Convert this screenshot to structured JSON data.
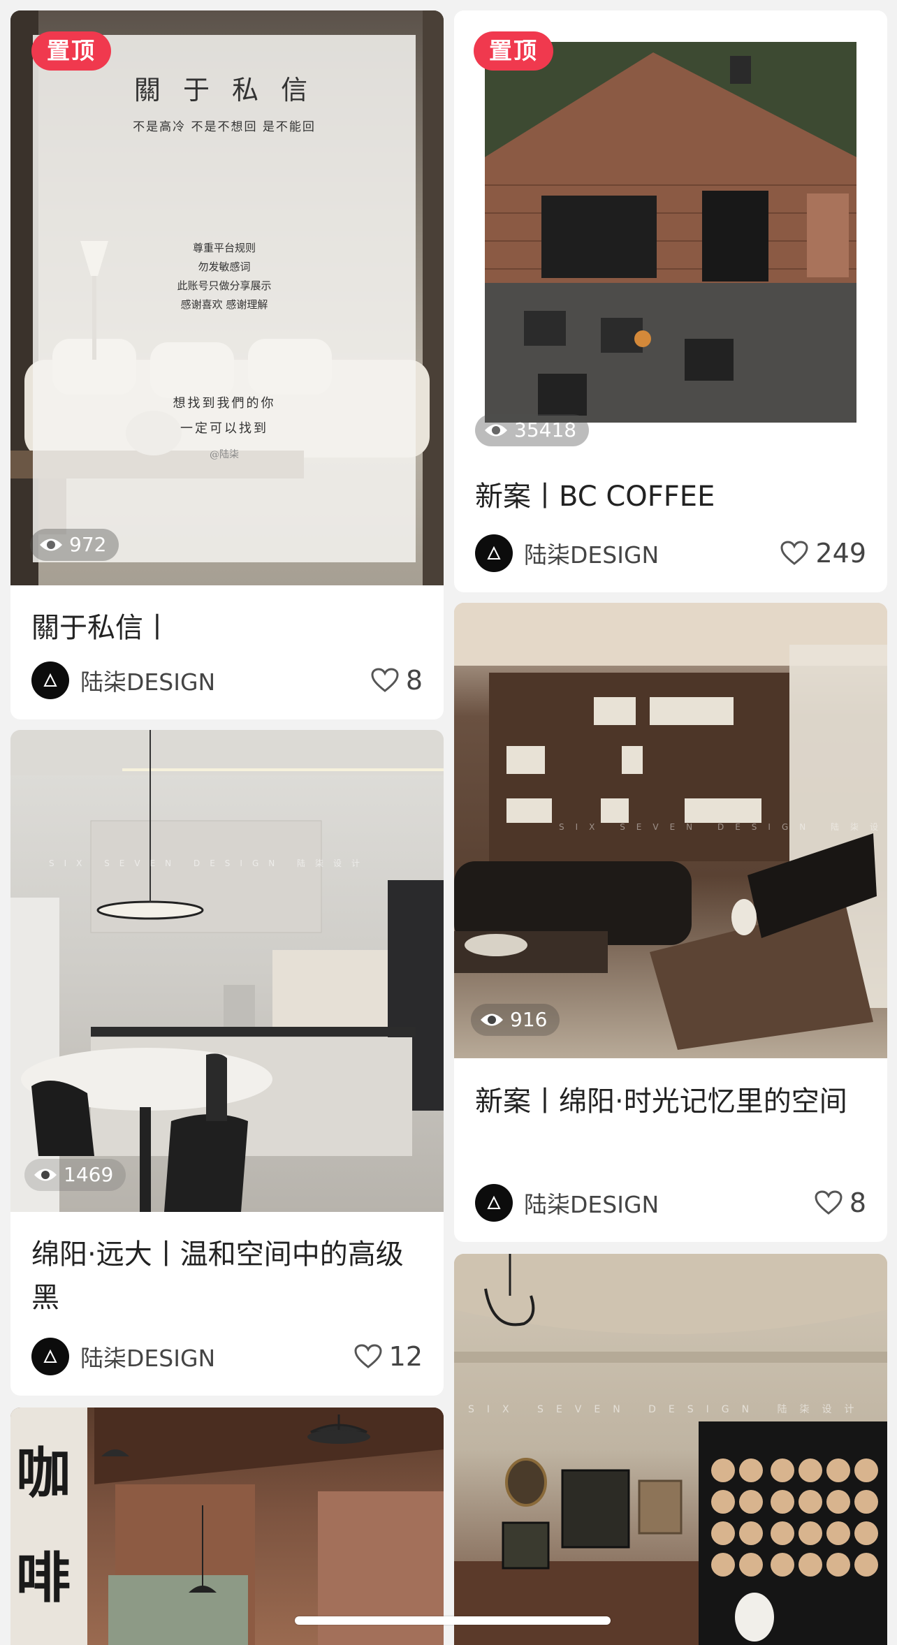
{
  "feed": {
    "cards": [
      {
        "pin_label": "置顶",
        "views": "972",
        "title": "關于私信丨",
        "author": "陆柒DESIGN",
        "likes": "8",
        "poster": {
          "heading": "關 于 私 信",
          "subheading": "不是高冷  不是不想回  是不能回",
          "rules": [
            "尊重平台规则",
            "勿发敏感词",
            "此账号只做分享展示",
            "感谢喜欢 感谢理解"
          ],
          "closing_line1": "想找到我們的你",
          "closing_line2": "一定可以找到",
          "handle": "@陆柒"
        }
      },
      {
        "pin_label": "置顶",
        "views": "35418",
        "title": "新案丨BC COFFEE",
        "author": "陆柒DESIGN",
        "likes": "249"
      },
      {
        "views": "916",
        "title": "新案丨绵阳·时光记忆里的空间",
        "author": "陆柒DESIGN",
        "likes": "8",
        "watermark": "SIX  SEVEN  DESIGN  陆柒设计"
      },
      {
        "views": "1469",
        "title": "绵阳·远大丨温和空间中的高级黑",
        "author": "陆柒DESIGN",
        "likes": "12",
        "watermark": "SIX  SEVEN  DESIGN  陆柒设计"
      },
      {
        "calligraphy": "咖啡"
      },
      {
        "watermark": "SIX  SEVEN  DESIGN  陆柒设计"
      }
    ]
  },
  "colors": {
    "pin_badge": "#f0394e",
    "background": "#f2f2f2",
    "card": "#ffffff"
  }
}
